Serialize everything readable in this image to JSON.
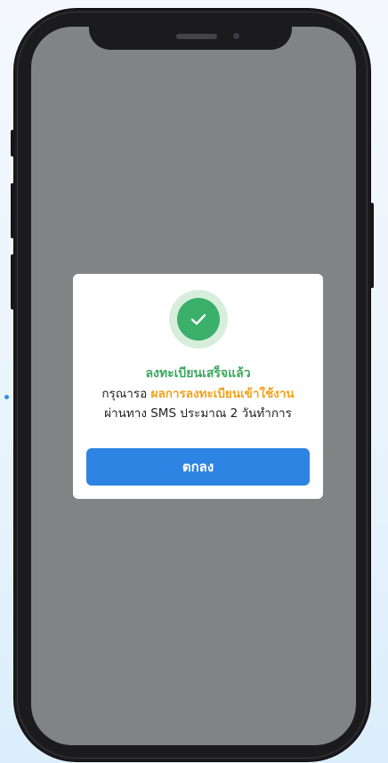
{
  "dialog": {
    "title": "ลงทะเบียนเสร็จแล้ว",
    "message_prefix": "กรุณารอ",
    "message_highlight": "ผลการลงทะเบียนเข้าใช้งาน",
    "message_line2": "ผ่านทาง SMS ประมาณ 2 วันทำการ",
    "ok_button_label": "ตกลง",
    "icon": "check-circle-icon"
  },
  "colors": {
    "success": "#3bb06a",
    "success_halo": "#d8eedd",
    "highlight": "#f2a21b",
    "primary_button": "#2e84e2",
    "overlay": "#828385"
  }
}
